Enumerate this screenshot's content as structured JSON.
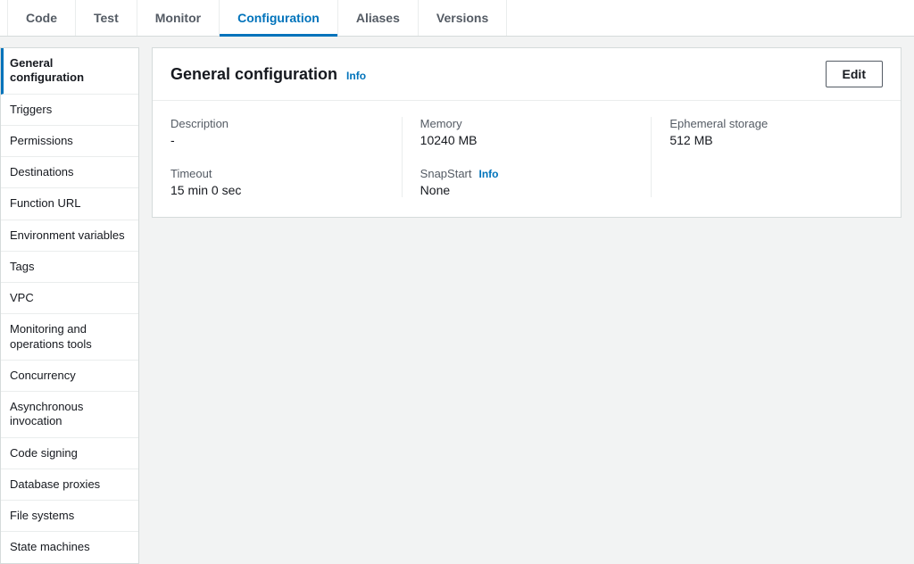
{
  "tabs": {
    "code": "Code",
    "test": "Test",
    "monitor": "Monitor",
    "configuration": "Configuration",
    "aliases": "Aliases",
    "versions": "Versions"
  },
  "sidebar": {
    "items": [
      "General configuration",
      "Triggers",
      "Permissions",
      "Destinations",
      "Function URL",
      "Environment variables",
      "Tags",
      "VPC",
      "Monitoring and operations tools",
      "Concurrency",
      "Asynchronous invocation",
      "Code signing",
      "Database proxies",
      "File systems",
      "State machines"
    ]
  },
  "panel": {
    "title": "General configuration",
    "info_label": "Info",
    "edit_label": "Edit",
    "fields": {
      "description_label": "Description",
      "description_value": "-",
      "timeout_label": "Timeout",
      "timeout_value": "15  min   0  sec",
      "memory_label": "Memory",
      "memory_value": "10240  MB",
      "snapstart_label": "SnapStart",
      "snapstart_info": "Info",
      "snapstart_value": "None",
      "storage_label": "Ephemeral storage",
      "storage_value": "512  MB"
    }
  }
}
